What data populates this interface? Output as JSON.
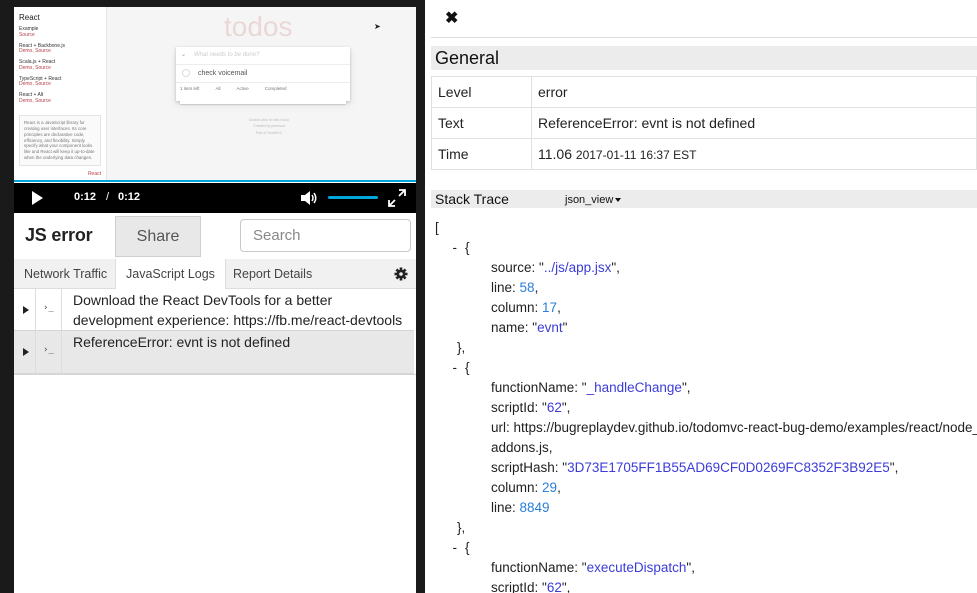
{
  "video": {
    "sidebar": {
      "title": "React",
      "items": [
        {
          "name": "Example",
          "sub": "Source"
        },
        {
          "name": "React + Backbone.js",
          "sub": "Demo, Source"
        },
        {
          "name": "Scala.js + React",
          "sub": "Demo, Source"
        },
        {
          "name": "TypeScript + React",
          "sub": "Demo, Source"
        },
        {
          "name": "React + Alt",
          "sub": "Demo, Source"
        }
      ],
      "quote": "React is a JavaScript library for creating user interfaces. Its core principles are declarative code, efficiency, and flexibility. Simply specify what your component looks like and React will keep it up-to-date when the underlying data changes.",
      "quote_brand": "React"
    },
    "todo_title": "todos",
    "todo_placeholder": "What needs to be done?",
    "todo_item": "check voicemail",
    "todo_footer": [
      "1 item left",
      "All",
      "Active",
      "Completed"
    ],
    "todo_info": [
      "Double-click to edit a todo",
      "Created by petehunt",
      "Part of TodoMVC"
    ],
    "time_current": "0:12",
    "time_separator": "/",
    "time_duration": "0:12",
    "progress": 1.0,
    "volume": 1.0
  },
  "toolbar": {
    "title": "JS error",
    "share_label": "Share",
    "search_placeholder": "Search"
  },
  "tabs": [
    {
      "label": "Network Traffic",
      "active": false
    },
    {
      "label": "JavaScript Logs",
      "active": true
    },
    {
      "label": "Report Details",
      "active": false
    }
  ],
  "logs": [
    {
      "text": "Download the React DevTools for a better development experience: https://fb.me/react-devtools",
      "selected": false
    },
    {
      "text": "ReferenceError: evnt is not defined",
      "selected": true
    }
  ],
  "console_glyph": "›_",
  "detail": {
    "close_glyph": "✖",
    "general_title": "General",
    "rows": [
      {
        "key": "Level",
        "value": "error"
      },
      {
        "key": "Text",
        "value": "ReferenceError: evnt is not defined"
      },
      {
        "key": "Time",
        "value": "11.06",
        "value_small": "2017-01-11 16:37 EST"
      }
    ],
    "stack_title": "Stack Trace",
    "json_view_label": "json_view",
    "stack": [
      {
        "source": "../js/app.jsx",
        "line": 58,
        "column": 17,
        "name": "evnt"
      },
      {
        "functionName": "_handleChange",
        "scriptId": "62",
        "url": "https://bugreplaydev.github.io/todomvc-react-bug-demo/examples/react/node_modules/react/dist/react-with-",
        "url_cont": "addons.js,",
        "scriptHash": "3D73E1705FF1B55AD69CF0D0269FC8352F3B92E5",
        "column": 29,
        "line": 8849
      },
      {
        "functionName": "executeDispatch",
        "scriptId": "62"
      }
    ]
  },
  "colors": {
    "accent": "#00a5d9",
    "json_string": "#3c3cd8",
    "json_number": "#2a7fd8"
  }
}
